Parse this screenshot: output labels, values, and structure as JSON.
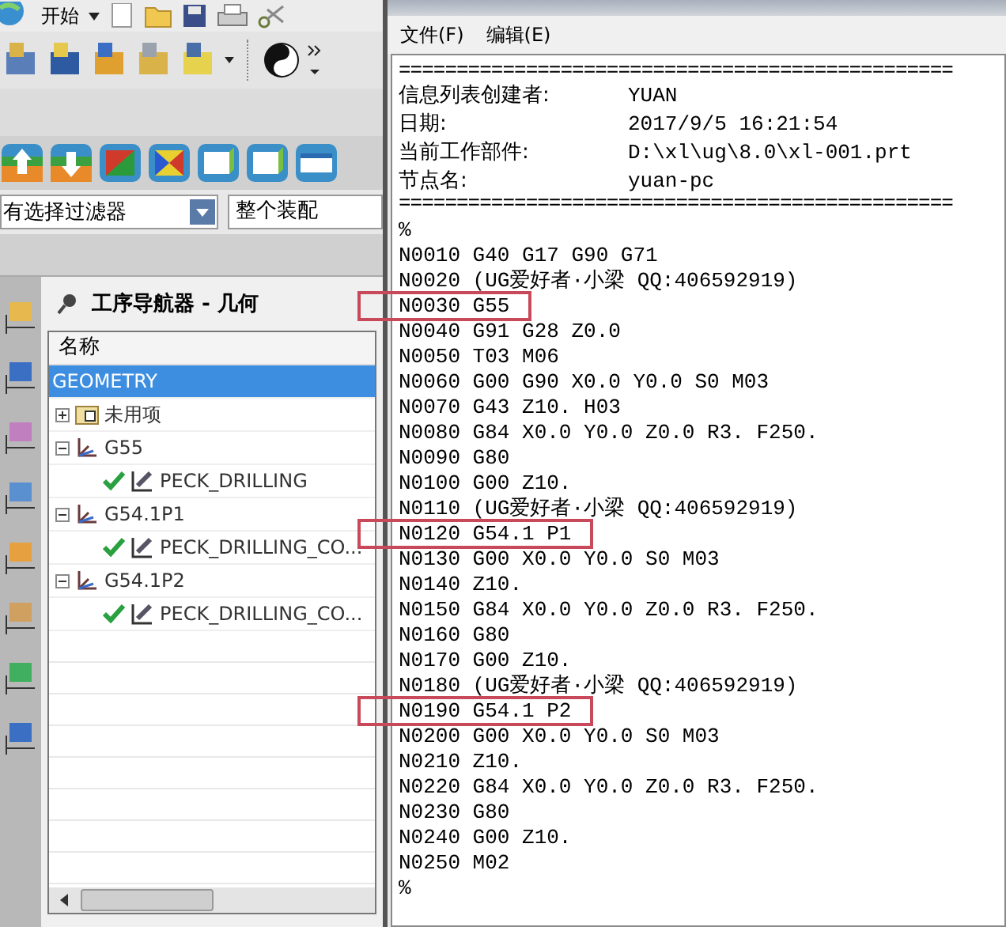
{
  "toolbar": {
    "start_menu": "开始"
  },
  "filter_bar": {
    "filter": "有选择过滤器",
    "scope": "整个装配"
  },
  "navigator": {
    "title": "工序导航器 - 几何",
    "column": "名称",
    "tree": [
      {
        "label": "GEOMETRY",
        "kind": "root",
        "selected": true,
        "children": [
          {
            "label": "未用项",
            "kind": "folder",
            "expanded": false,
            "selected": false
          },
          {
            "label": "G55",
            "kind": "csys",
            "expanded": true,
            "selected": false,
            "children": [
              {
                "label": "PECK_DRILLING",
                "kind": "operation",
                "selected": false
              }
            ]
          },
          {
            "label": "G54.1P1",
            "kind": "csys",
            "expanded": true,
            "selected": false,
            "children": [
              {
                "label": "PECK_DRILLING_CO...",
                "kind": "operation",
                "selected": false
              }
            ]
          },
          {
            "label": "G54.1P2",
            "kind": "csys",
            "expanded": true,
            "selected": false,
            "children": [
              {
                "label": "PECK_DRILLING_CO...",
                "kind": "operation",
                "selected": false
              }
            ]
          }
        ]
      }
    ]
  },
  "info_window": {
    "menu": [
      "文件(F)",
      "编辑(E)"
    ],
    "rule": "================================================",
    "fields": [
      {
        "label": "信息列表创建者:",
        "value": "YUAN"
      },
      {
        "label": "日期:",
        "value": "2017/9/5 16:21:54"
      },
      {
        "label": "当前工作部件:",
        "value": "D:\\xl\\ug\\8.0\\xl-001.prt"
      },
      {
        "label": "节点名:",
        "value": "yuan-pc"
      }
    ],
    "lines": [
      {
        "text": "%",
        "highlighted": false
      },
      {
        "text": "N0010 G40 G17 G90 G71",
        "highlighted": false
      },
      {
        "text": "N0020 (UG爱好者·小梁 QQ:406592919)",
        "highlighted": false
      },
      {
        "text": "N0030 G55",
        "highlighted": true
      },
      {
        "text": "N0040 G91 G28 Z0.0",
        "highlighted": false
      },
      {
        "text": "N0050 T03 M06",
        "highlighted": false
      },
      {
        "text": "N0060 G00 G90 X0.0 Y0.0 S0 M03",
        "highlighted": false
      },
      {
        "text": "N0070 G43 Z10. H03",
        "highlighted": false
      },
      {
        "text": "N0080 G84 X0.0 Y0.0 Z0.0 R3. F250.",
        "highlighted": false
      },
      {
        "text": "N0090 G80",
        "highlighted": false
      },
      {
        "text": "N0100 G00 Z10.",
        "highlighted": false
      },
      {
        "text": "N0110 (UG爱好者·小梁 QQ:406592919)",
        "highlighted": false
      },
      {
        "text": "N0120 G54.1 P1",
        "highlighted": true
      },
      {
        "text": "N0130 G00 X0.0 Y0.0 S0 M03",
        "highlighted": false
      },
      {
        "text": "N0140 Z10.",
        "highlighted": false
      },
      {
        "text": "N0150 G84 X0.0 Y0.0 Z0.0 R3. F250.",
        "highlighted": false
      },
      {
        "text": "N0160 G80",
        "highlighted": false
      },
      {
        "text": "N0170 G00 Z10.",
        "highlighted": false
      },
      {
        "text": "N0180 (UG爱好者·小梁 QQ:406592919)",
        "highlighted": false
      },
      {
        "text": "N0190 G54.1 P2",
        "highlighted": true
      },
      {
        "text": "N0200 G00 X0.0 Y0.0 S0 M03",
        "highlighted": false
      },
      {
        "text": "N0210 Z10.",
        "highlighted": false
      },
      {
        "text": "N0220 G84 X0.0 Y0.0 Z0.0 R3. F250.",
        "highlighted": false
      },
      {
        "text": "N0230 G80",
        "highlighted": false
      },
      {
        "text": "N0240 G00 Z10.",
        "highlighted": false
      },
      {
        "text": "N0250 M02",
        "highlighted": false
      },
      {
        "text": "%",
        "highlighted": false
      }
    ]
  }
}
